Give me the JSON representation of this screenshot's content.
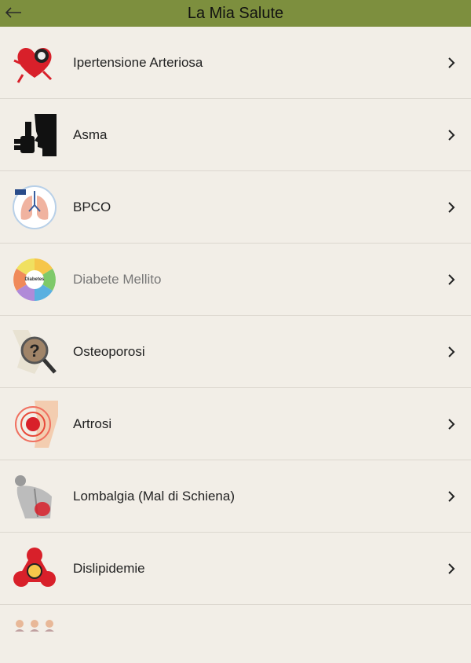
{
  "header": {
    "title": "La Mia Salute",
    "back_icon": "arrow-left-icon"
  },
  "items": [
    {
      "label": "Ipertensione Arteriosa",
      "icon": "heart-runner-icon"
    },
    {
      "label": "Asma",
      "icon": "inhaler-person-icon"
    },
    {
      "label": "BPCO",
      "icon": "lungs-icon"
    },
    {
      "label": "Diabete Mellito",
      "icon": "diabetes-wheel-icon",
      "icon_text": "Diabetes"
    },
    {
      "label": "Osteoporosi",
      "icon": "bone-magnifier-icon"
    },
    {
      "label": "Artrosi",
      "icon": "knee-pain-icon"
    },
    {
      "label": "Lombalgia (Mal di Schiena)",
      "icon": "back-pain-icon"
    },
    {
      "label": "Dislipidemie",
      "icon": "lipid-molecule-icon"
    }
  ],
  "colors": {
    "topbar": "#7d8f3e",
    "background": "#f2eee7",
    "divider": "#dcd7cf"
  }
}
